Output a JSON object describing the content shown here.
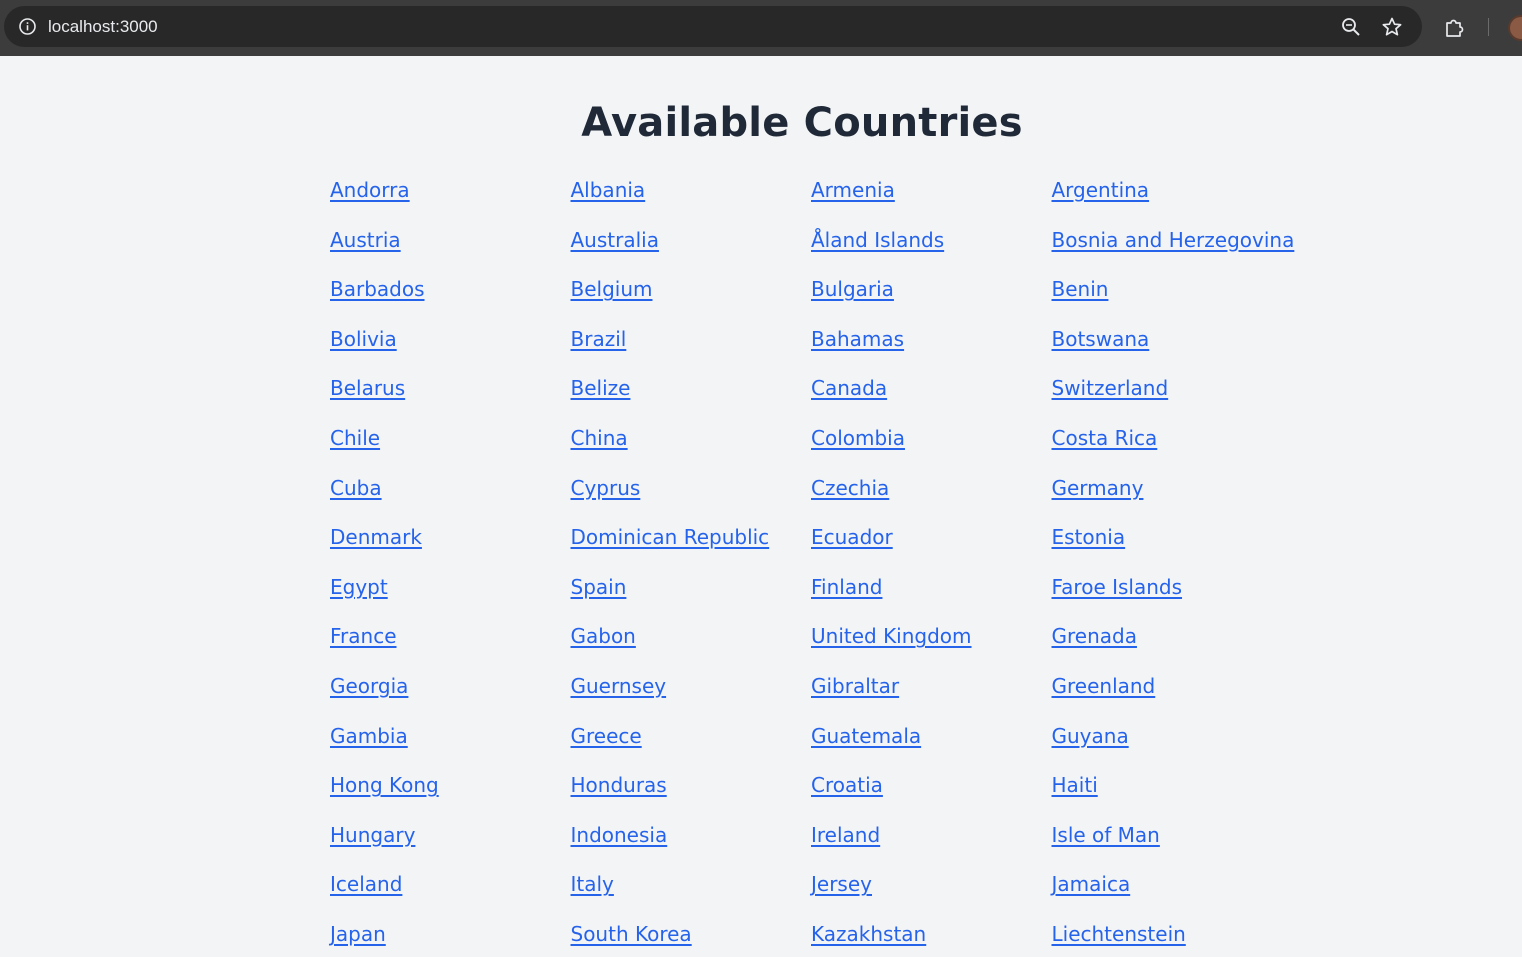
{
  "browser": {
    "url": "localhost:3000",
    "icons": [
      "info-icon",
      "zoom-icon",
      "star-icon",
      "extensions-icon",
      "avatar"
    ]
  },
  "page": {
    "title": "Available Countries"
  },
  "countries": [
    "Andorra",
    "Albania",
    "Armenia",
    "Argentina",
    "Austria",
    "Australia",
    "Åland Islands",
    "Bosnia and Herzegovina",
    "Barbados",
    "Belgium",
    "Bulgaria",
    "Benin",
    "Bolivia",
    "Brazil",
    "Bahamas",
    "Botswana",
    "Belarus",
    "Belize",
    "Canada",
    "Switzerland",
    "Chile",
    "China",
    "Colombia",
    "Costa Rica",
    "Cuba",
    "Cyprus",
    "Czechia",
    "Germany",
    "Denmark",
    "Dominican Republic",
    "Ecuador",
    "Estonia",
    "Egypt",
    "Spain",
    "Finland",
    "Faroe Islands",
    "France",
    "Gabon",
    "United Kingdom",
    "Grenada",
    "Georgia",
    "Guernsey",
    "Gibraltar",
    "Greenland",
    "Gambia",
    "Greece",
    "Guatemala",
    "Guyana",
    "Hong Kong",
    "Honduras",
    "Croatia",
    "Haiti",
    "Hungary",
    "Indonesia",
    "Ireland",
    "Isle of Man",
    "Iceland",
    "Italy",
    "Jersey",
    "Jamaica",
    "Japan",
    "South Korea",
    "Kazakhstan",
    "Liechtenstein"
  ],
  "colors": {
    "page_background": "#f3f4f6",
    "link": "#2563eb",
    "title": "#1f2937",
    "browser_bar": "#3c3c3c",
    "omnibox": "#282828"
  }
}
